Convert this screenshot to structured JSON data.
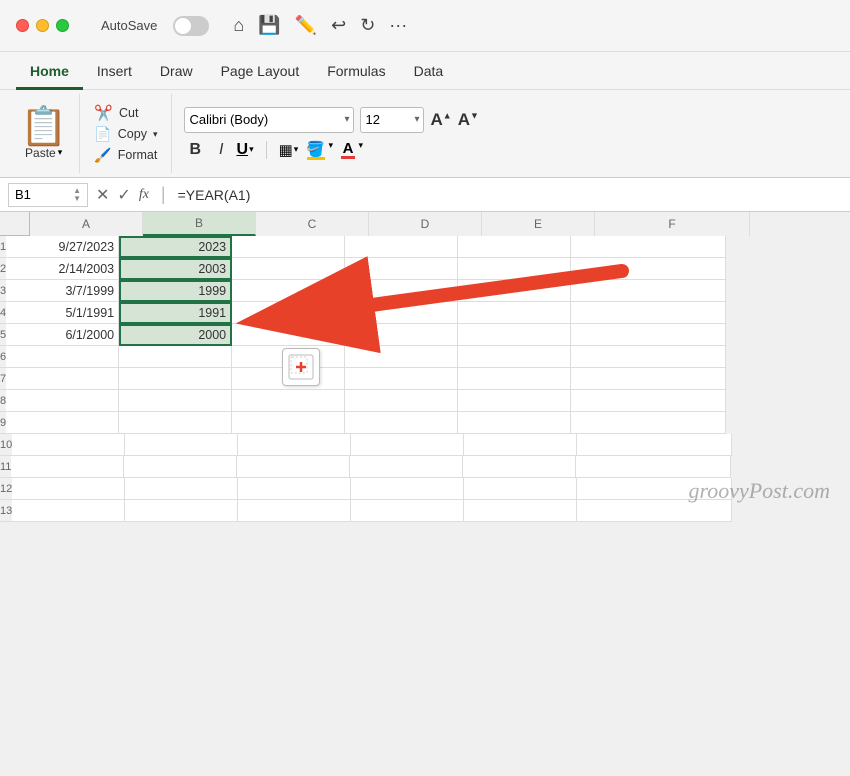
{
  "titleBar": {
    "trafficLights": [
      "red",
      "yellow",
      "green"
    ],
    "autosave": "AutoSave",
    "icons": [
      "home",
      "save",
      "edit",
      "undo",
      "redo",
      "more"
    ]
  },
  "ribbonTabs": [
    {
      "label": "Home",
      "active": true
    },
    {
      "label": "Insert",
      "active": false
    },
    {
      "label": "Draw",
      "active": false
    },
    {
      "label": "Page Layout",
      "active": false
    },
    {
      "label": "Formulas",
      "active": false
    },
    {
      "label": "Data",
      "active": false
    }
  ],
  "clipboard": {
    "paste": "Paste",
    "cut": "Cut",
    "copy": "Copy",
    "format": "Format"
  },
  "font": {
    "name": "Calibri (Body)",
    "size": "12",
    "bold": "B",
    "italic": "I",
    "underline": "U"
  },
  "formulaBar": {
    "cellRef": "B1",
    "formula": "=YEAR(A1)"
  },
  "columns": [
    "A",
    "B",
    "C",
    "D",
    "E",
    "F"
  ],
  "rows": [
    {
      "num": 1,
      "a": "9/27/2023",
      "b": "2023"
    },
    {
      "num": 2,
      "a": "2/14/2003",
      "b": "2003"
    },
    {
      "num": 3,
      "a": "3/7/1999",
      "b": "1999"
    },
    {
      "num": 4,
      "a": "5/1/1991",
      "b": "1991"
    },
    {
      "num": 5,
      "a": "6/1/2000",
      "b": "2000"
    },
    {
      "num": 6,
      "a": "",
      "b": ""
    },
    {
      "num": 7,
      "a": "",
      "b": ""
    },
    {
      "num": 8,
      "a": "",
      "b": ""
    },
    {
      "num": 9,
      "a": "",
      "b": ""
    },
    {
      "num": 10,
      "a": "",
      "b": ""
    },
    {
      "num": 11,
      "a": "",
      "b": ""
    },
    {
      "num": 12,
      "a": "",
      "b": ""
    },
    {
      "num": 13,
      "a": "",
      "b": ""
    }
  ],
  "watermark": "groovyPost.com",
  "pasteFloat": "⊞"
}
